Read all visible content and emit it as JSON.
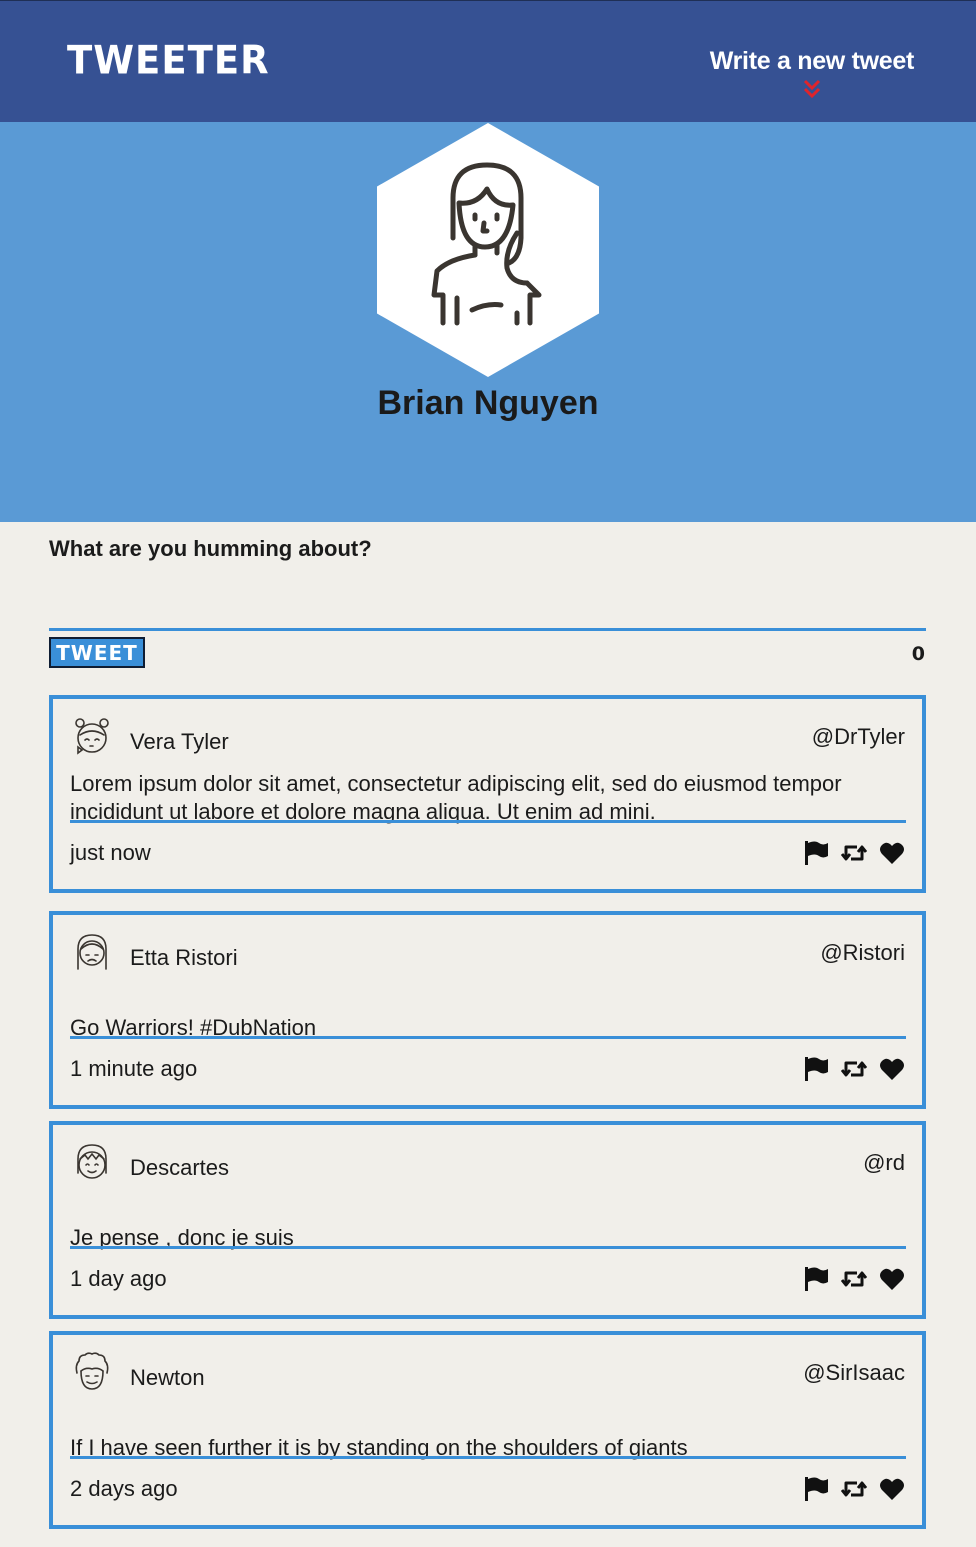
{
  "nav": {
    "logo": "TWEETER",
    "compose_label": "Write a new tweet",
    "chevron_icon": "double-chevron-down-icon",
    "bg_color": "#365193",
    "chevron_color": "#e0242b"
  },
  "profile": {
    "name": "Brian Nguyen",
    "avatar_icon": "person-avatar-icon",
    "bg_color": "#5a9ad5"
  },
  "composer": {
    "prompt": "What are you humming about?",
    "button_label": "TWEET",
    "counter": "0",
    "accent_color": "#3a8fd8"
  },
  "tweets": [
    {
      "name": "Vera Tyler",
      "handle": "@DrTyler",
      "body": "Lorem ipsum dolor sit amet, consectetur adipiscing elit, sed do eiusmod tempor incididunt ut labore et dolore magna aliqua. Ut enim ad mini.",
      "time": "just now",
      "avatar_icon": "girl-kiss-avatar-icon"
    },
    {
      "name": "Etta Ristori",
      "handle": "@Ristori",
      "body": "Go Warriors! #DubNation",
      "time": "1 minute ago",
      "avatar_icon": "sad-woman-avatar-icon"
    },
    {
      "name": "Descartes",
      "handle": "@rd",
      "body": "Je pense , donc je suis",
      "time": "1 day ago",
      "avatar_icon": "smiling-man-avatar-icon"
    },
    {
      "name": "Newton",
      "handle": "@SirIsaac",
      "body": "If I have seen further it is by standing on the shoulders of giants",
      "time": "2 days ago",
      "avatar_icon": "curly-hair-avatar-icon"
    }
  ],
  "tweet_actions": [
    "flag-icon",
    "retweet-icon",
    "heart-icon"
  ]
}
